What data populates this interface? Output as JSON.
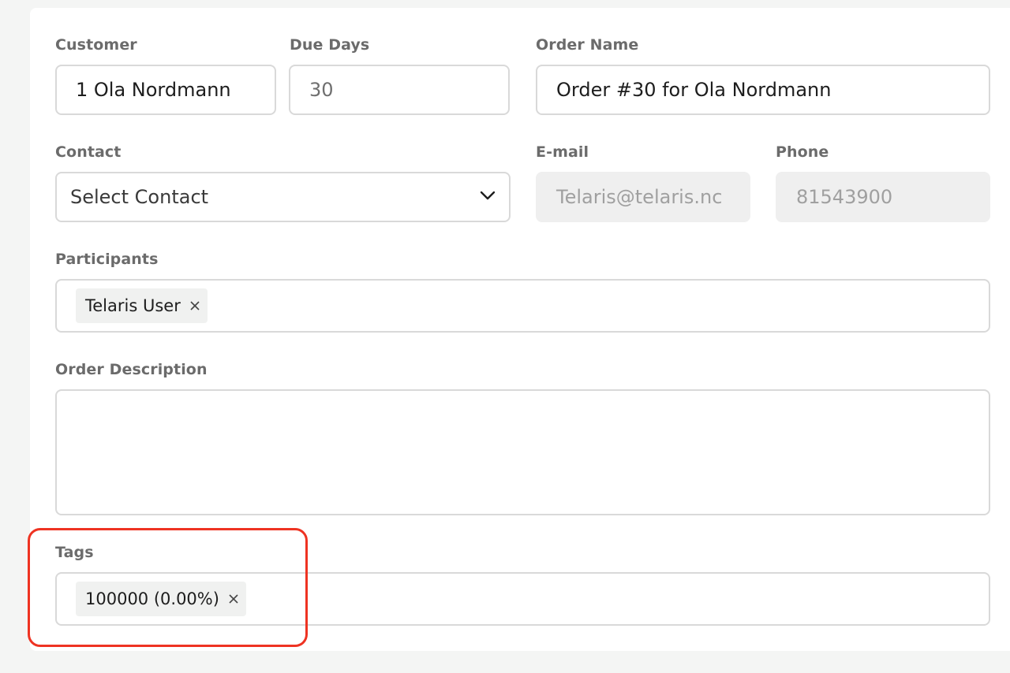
{
  "form": {
    "customer": {
      "label": "Customer",
      "value": "1 Ola Nordmann"
    },
    "due_days": {
      "label": "Due Days",
      "value": "30"
    },
    "order_name": {
      "label": "Order Name",
      "value": "Order #30 for Ola Nordmann"
    },
    "contact": {
      "label": "Contact",
      "value": "Select Contact"
    },
    "email": {
      "label": "E-mail",
      "value": "Telaris@telaris.nc"
    },
    "phone": {
      "label": "Phone",
      "value": "81543900"
    },
    "participants": {
      "label": "Participants",
      "chips": [
        "Telaris User"
      ]
    },
    "order_description": {
      "label": "Order Description",
      "value": ""
    },
    "tags": {
      "label": "Tags",
      "chips": [
        "100000 (0.00%)"
      ]
    }
  },
  "icons": {
    "dropdown": "chevron-down-icon",
    "remove": "close-icon"
  },
  "colors": {
    "highlight": "#ee3322",
    "label": "#6b6b6b",
    "disabled_bg": "#efefef"
  }
}
